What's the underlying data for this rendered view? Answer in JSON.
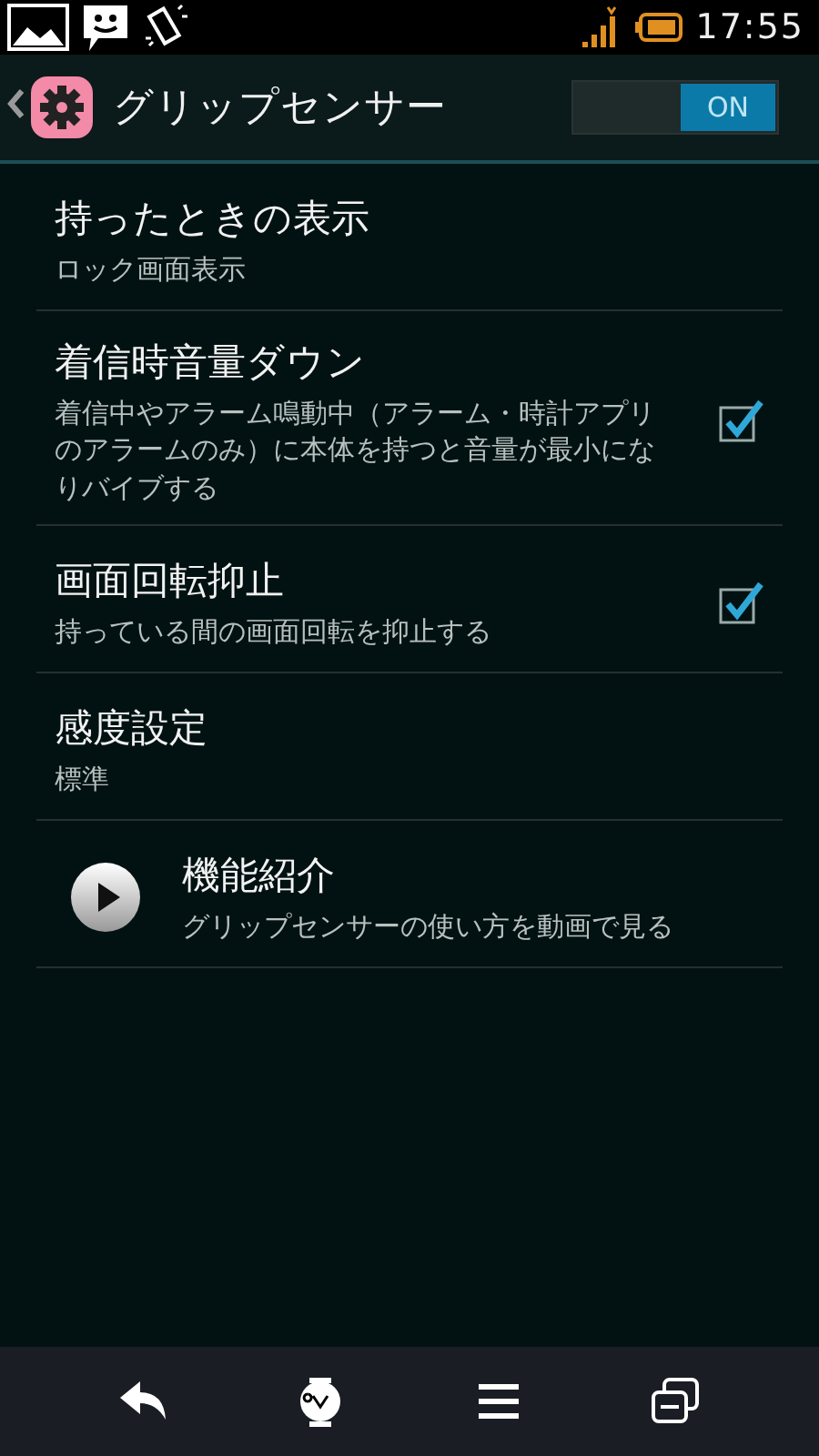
{
  "status_bar": {
    "time": "17:55"
  },
  "header": {
    "title": "グリップセンサー",
    "switch": {
      "label": "ON",
      "on": true
    }
  },
  "items": [
    {
      "kind": "text",
      "title": "持ったときの表示",
      "summary": "ロック画面表示"
    },
    {
      "kind": "check",
      "title": "着信時音量ダウン",
      "summary": "着信中やアラーム鳴動中（アラーム・時計アプリのアラームのみ）に本体を持つと音量が最小になりバイブする",
      "checked": true
    },
    {
      "kind": "check",
      "title": "画面回転抑止",
      "summary": "持っている間の画面回転を抑止する",
      "checked": true
    },
    {
      "kind": "text",
      "title": "感度設定",
      "summary": "標準"
    },
    {
      "kind": "video",
      "title": "機能紹介",
      "summary": "グリップセンサーの使い方を動画で見る"
    }
  ]
}
